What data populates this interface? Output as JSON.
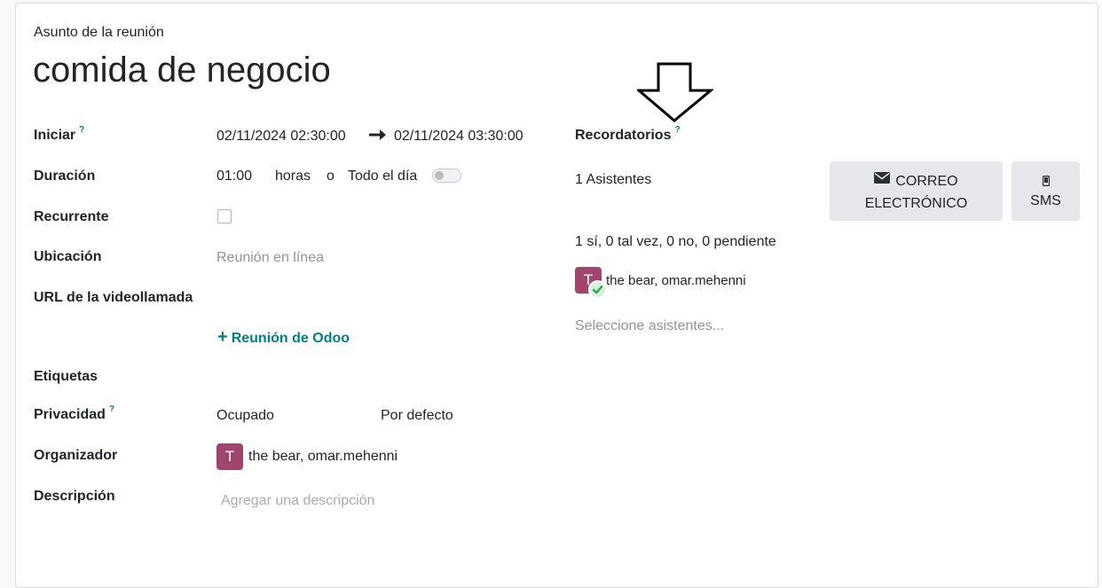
{
  "form": {
    "subject_label": "Asunto de la reunión",
    "title": "comida de negocio"
  },
  "fields": {
    "start_label": "Iniciar",
    "start_help": "?",
    "start_value": "02/11/2024 02:30:00",
    "end_value": "02/11/2024 03:30:00",
    "duration_label": "Duración",
    "duration_value": "01:00",
    "duration_unit": "horas",
    "duration_or": "o",
    "allday_label": "Todo el día",
    "allday_on": false,
    "recurrent_label": "Recurrente",
    "recurrent_checked": false,
    "location_label": "Ubicación",
    "location_placeholder": "Reunión en línea",
    "videocall_label": "URL de la videollamada",
    "odoo_meeting_link": "Reunión de Odoo",
    "tags_label": "Etiquetas",
    "privacy_label": "Privacidad",
    "privacy_help": "?",
    "privacy_show_as": "Ocupado",
    "privacy_value": "Por defecto",
    "organizer_label": "Organizador",
    "organizer_initial": "T",
    "organizer_name": "the bear, omar.mehenni",
    "description_label": "Descripción",
    "description_placeholder": "Agregar una descripción"
  },
  "reminders": {
    "label": "Recordatorios",
    "help": "?"
  },
  "attendees": {
    "count_label": "1 Asistentes",
    "summary": "1 sí, 0 tal vez, 0 no, 0 pendiente",
    "list": [
      {
        "initial": "T",
        "name": "the bear, omar.mehenni",
        "status": "accepted"
      }
    ],
    "select_placeholder": "Seleccione asistentes..."
  },
  "buttons": {
    "email_line1": "CORREO",
    "email_line2": "ELECTRÓNICO",
    "sms": "SMS"
  },
  "colors": {
    "accent": "#017e84",
    "avatar": "#a2456e",
    "accepted": "#28a745"
  },
  "icons": [
    "arrow-right-icon",
    "envelope-icon",
    "mobile-phone-icon",
    "plus-icon",
    "check-circle-icon",
    "down-arrow-annotation-icon"
  ]
}
